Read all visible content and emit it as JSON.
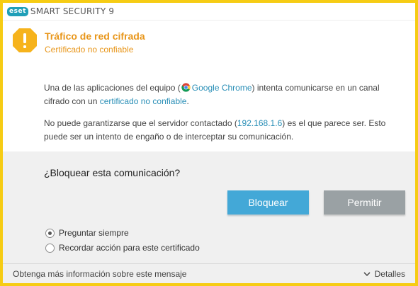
{
  "app": {
    "logo_text": "eset",
    "title": "SMART SECURITY 9"
  },
  "alert": {
    "title": "Tráfico de red cifrada",
    "subtitle": "Certificado no confiable",
    "icon": "warning-icon",
    "accent_color": "#e8961a"
  },
  "message": {
    "p1_before": "Una de las aplicaciones del equipo (",
    "app_icon": "chrome-icon",
    "app_name": "Google Chrome",
    "p1_middle": ") intenta comunicarse en un canal cifrado con un ",
    "cert_link": "certificado no confiable",
    "p1_after": ".",
    "p2_before": "No puede garantizarse que el servidor contactado (",
    "server_ip": "192.168.1.6",
    "p2_after": ") es el que parece ser. Esto puede ser un intento de engaño o de interceptar su comunicación."
  },
  "question": "¿Bloquear esta comunicación?",
  "buttons": {
    "block_label": "Bloquear",
    "allow_label": "Permitir",
    "block_color": "#43a8d7",
    "allow_color": "#9aa1a4"
  },
  "options": [
    {
      "label": "Preguntar siempre",
      "checked": true
    },
    {
      "label": "Recordar acción para este certificado",
      "checked": false
    }
  ],
  "footer": {
    "info_text": "Obtenga más información sobre este mensaje",
    "details_label": "Detalles",
    "details_icon": "chevron-down-icon"
  }
}
